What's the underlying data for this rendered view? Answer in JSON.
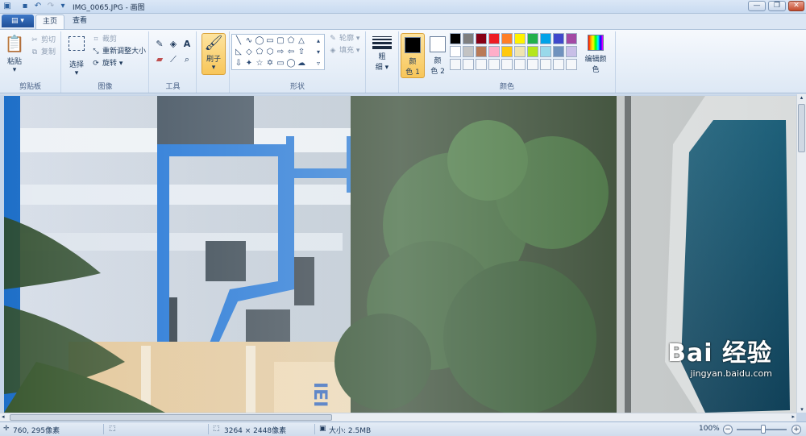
{
  "window": {
    "title": "IMG_0065.JPG - 画图",
    "min_glyph": "—",
    "max_glyph": "❐",
    "close_glyph": "✕"
  },
  "tabs": {
    "home": "主页",
    "view": "查看"
  },
  "ribbon": {
    "clipboard": {
      "paste": "粘贴",
      "cut": "剪切",
      "copy": "复制",
      "group": "剪贴板"
    },
    "image": {
      "select": "选择",
      "crop": "裁剪",
      "resize": "重新调整大小",
      "rotate": "旋转",
      "group": "图像"
    },
    "tools": {
      "group": "工具"
    },
    "brushes": {
      "label": "刷子"
    },
    "shapes": {
      "outline": "轮廓",
      "fill": "填充",
      "group": "形状"
    },
    "size": {
      "label_line1": "粗",
      "label_line2": "细"
    },
    "colors": {
      "color1_line1": "颜",
      "color1_line2": "色 1",
      "color2_line1": "颜",
      "color2_line2": "色 2",
      "edit": "编辑颜色",
      "group": "颜色",
      "color1": "#000000",
      "color2": "#ffffff",
      "palette": [
        "#000000",
        "#7f7f7f",
        "#880015",
        "#ed1c24",
        "#ff7f27",
        "#fff200",
        "#22b14c",
        "#00a2e8",
        "#3f48cc",
        "#a349a4",
        "#ffffff",
        "#c3c3c3",
        "#b97a57",
        "#ffaec9",
        "#ffc90e",
        "#efe4b0",
        "#b5e61d",
        "#99d9ea",
        "#7092be",
        "#c8bfe7",
        "#f5f7fa",
        "#f5f7fa",
        "#f5f7fa",
        "#f5f7fa",
        "#f5f7fa",
        "#f5f7fa",
        "#f5f7fa",
        "#f5f7fa",
        "#f5f7fa",
        "#f5f7fa"
      ]
    }
  },
  "status": {
    "cursor": "760, 295像素",
    "dimensions": "3264 × 2448像素",
    "size": "大小: 2.5MB",
    "zoom": "100%"
  },
  "watermark": {
    "main": "Bai 经验",
    "sub": "jingyan.baidu.com"
  }
}
